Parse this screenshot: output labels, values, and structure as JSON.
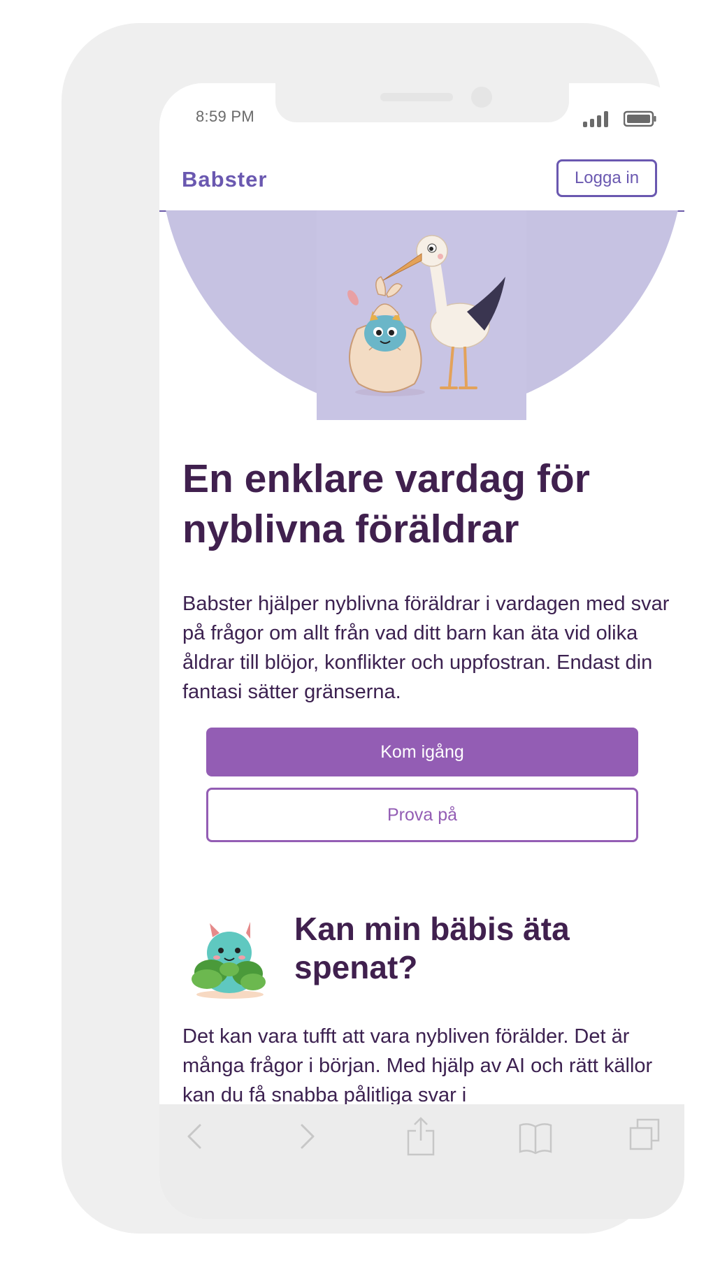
{
  "status_bar": {
    "time": "8:59 PM"
  },
  "header": {
    "logo": "Babster",
    "login_label": "Logga in"
  },
  "hero": {
    "headline": "En enklare vardag för nyblivna föräldrar",
    "intro": "Babster hjälper nyblivna föräldrar i vardagen med svar på frågor om allt från vad ditt barn kan äta vid olika åldrar till blöjor, konflikter och uppfostran. Endast din fantasi sätter gränserna.",
    "primary_cta": "Kom igång",
    "secondary_cta": "Prova på"
  },
  "feature": {
    "title": "Kan min bäbis äta spenat?",
    "text": "Det kan vara tufft att vara nybliven förälder. Det är många frågor i början. Med hjälp av AI och rätt källor kan du få snabba pålitliga svar i"
  },
  "toolbar": {
    "icons": [
      "back-icon",
      "forward-icon",
      "share-icon",
      "bookmarks-icon",
      "tabs-icon"
    ]
  },
  "colors": {
    "brand": "#6a58b0",
    "cta": "#935db4",
    "heading": "#40204e",
    "hero_bg": "#c6c2e2"
  }
}
